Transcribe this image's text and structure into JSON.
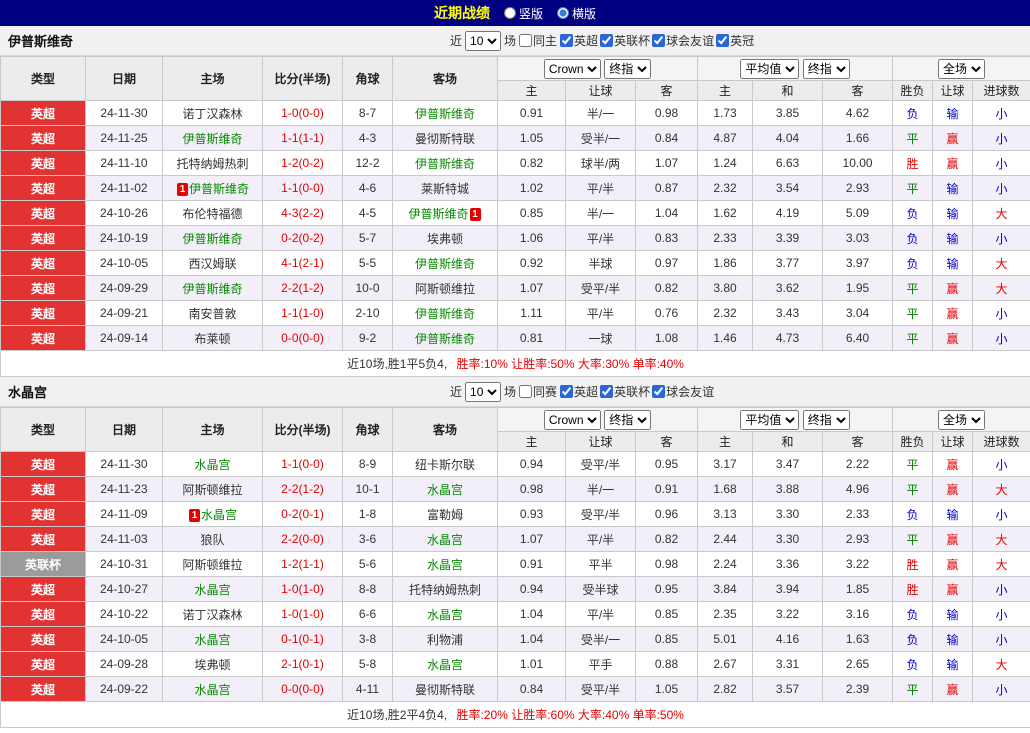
{
  "topbar": {
    "title": "近期战绩",
    "vertical": "竖版",
    "horizontal": "横版"
  },
  "filters_shared": {
    "near": "近",
    "count": "10",
    "games": "场"
  },
  "dropdowns": {
    "bookmaker": "Crown",
    "final": "终指",
    "average": "平均值",
    "full": "全场"
  },
  "columns": {
    "type": "类型",
    "date": "日期",
    "home": "主场",
    "score": "比分(半场)",
    "corner": "角球",
    "away": "客场",
    "odds_home": "主",
    "handicap": "让球",
    "odds_away": "客",
    "avg_home": "主",
    "avg_draw": "和",
    "avg_away": "客",
    "result": "胜负",
    "handicap_result": "让球",
    "goals": "进球数"
  },
  "colors": {
    "value": {
      "胜": "#e60000",
      "平": "#007b00",
      "负": "#0000d0",
      "赢": "#e60000",
      "输": "#0000d0",
      "大": "#e60000",
      "小": "#0000d0"
    },
    "league": {
      "英超": "#e23333",
      "英联杯": "#9b9b9b"
    },
    "score": "#e60000",
    "focus_team": "#078a00"
  },
  "sections": [
    {
      "team": "伊普斯维奇",
      "filter": {
        "same_label": "同主",
        "leagues": [
          "英超",
          "英联杯",
          "球会友谊",
          "英冠"
        ]
      },
      "rows": [
        {
          "league": "英超",
          "date": "24-11-30",
          "home": {
            "name": "诺丁汉森林"
          },
          "score": "1-0(0-0)",
          "corner": "8-7",
          "away": {
            "name": "伊普斯维奇",
            "focus": true
          },
          "odds": [
            "0.91",
            "半/一",
            "0.98"
          ],
          "avg": [
            "1.73",
            "3.85",
            "4.62"
          ],
          "results": [
            "负",
            "输",
            "小"
          ]
        },
        {
          "league": "英超",
          "date": "24-11-25",
          "home": {
            "name": "伊普斯维奇",
            "focus": true
          },
          "score": "1-1(1-1)",
          "corner": "4-3",
          "away": {
            "name": "曼彻斯特联"
          },
          "odds": [
            "1.05",
            "受半/一",
            "0.84"
          ],
          "avg": [
            "4.87",
            "4.04",
            "1.66"
          ],
          "results": [
            "平",
            "赢",
            "小"
          ]
        },
        {
          "league": "英超",
          "date": "24-11-10",
          "home": {
            "name": "托特纳姆热刺"
          },
          "score": "1-2(0-2)",
          "corner": "12-2",
          "away": {
            "name": "伊普斯维奇",
            "focus": true
          },
          "odds": [
            "0.82",
            "球半/两",
            "1.07"
          ],
          "avg": [
            "1.24",
            "6.63",
            "10.00"
          ],
          "results": [
            "胜",
            "赢",
            "小"
          ]
        },
        {
          "league": "英超",
          "date": "24-11-02",
          "home": {
            "name": "伊普斯维奇",
            "focus": true,
            "card": "before"
          },
          "score": "1-1(0-0)",
          "corner": "4-6",
          "away": {
            "name": "莱斯特城"
          },
          "odds": [
            "1.02",
            "平/半",
            "0.87"
          ],
          "avg": [
            "2.32",
            "3.54",
            "2.93"
          ],
          "results": [
            "平",
            "输",
            "小"
          ]
        },
        {
          "league": "英超",
          "date": "24-10-26",
          "home": {
            "name": "布伦特福德"
          },
          "score": "4-3(2-2)",
          "corner": "4-5",
          "away": {
            "name": "伊普斯维奇",
            "focus": true,
            "card": "after"
          },
          "odds": [
            "0.85",
            "半/一",
            "1.04"
          ],
          "avg": [
            "1.62",
            "4.19",
            "5.09"
          ],
          "results": [
            "负",
            "输",
            "大"
          ]
        },
        {
          "league": "英超",
          "date": "24-10-19",
          "home": {
            "name": "伊普斯维奇",
            "focus": true
          },
          "score": "0-2(0-2)",
          "corner": "5-7",
          "away": {
            "name": "埃弗顿"
          },
          "odds": [
            "1.06",
            "平/半",
            "0.83"
          ],
          "avg": [
            "2.33",
            "3.39",
            "3.03"
          ],
          "results": [
            "负",
            "输",
            "小"
          ]
        },
        {
          "league": "英超",
          "date": "24-10-05",
          "home": {
            "name": "西汉姆联"
          },
          "score": "4-1(2-1)",
          "corner": "5-5",
          "away": {
            "name": "伊普斯维奇",
            "focus": true
          },
          "odds": [
            "0.92",
            "半球",
            "0.97"
          ],
          "avg": [
            "1.86",
            "3.77",
            "3.97"
          ],
          "results": [
            "负",
            "输",
            "大"
          ]
        },
        {
          "league": "英超",
          "date": "24-09-29",
          "home": {
            "name": "伊普斯维奇",
            "focus": true
          },
          "score": "2-2(1-2)",
          "corner": "10-0",
          "away": {
            "name": "阿斯顿维拉"
          },
          "odds": [
            "1.07",
            "受平/半",
            "0.82"
          ],
          "avg": [
            "3.80",
            "3.62",
            "1.95"
          ],
          "results": [
            "平",
            "赢",
            "大"
          ]
        },
        {
          "league": "英超",
          "date": "24-09-21",
          "home": {
            "name": "南安普敦"
          },
          "score": "1-1(1-0)",
          "corner": "2-10",
          "away": {
            "name": "伊普斯维奇",
            "focus": true
          },
          "odds": [
            "1.11",
            "平/半",
            "0.76"
          ],
          "avg": [
            "2.32",
            "3.43",
            "3.04"
          ],
          "results": [
            "平",
            "赢",
            "小"
          ]
        },
        {
          "league": "英超",
          "date": "24-09-14",
          "home": {
            "name": "布莱顿"
          },
          "score": "0-0(0-0)",
          "corner": "9-2",
          "away": {
            "name": "伊普斯维奇",
            "focus": true
          },
          "odds": [
            "0.81",
            "一球",
            "1.08"
          ],
          "avg": [
            "1.46",
            "4.73",
            "6.40"
          ],
          "results": [
            "平",
            "赢",
            "小"
          ]
        }
      ],
      "summary": {
        "record": "近10场,胜1平5负4,",
        "stats": "胜率:10% 让胜率:50% 大率:30% 单率:40%"
      }
    },
    {
      "team": "水晶宫",
      "filter": {
        "same_label": "同赛",
        "leagues": [
          "英超",
          "英联杯",
          "球会友谊"
        ]
      },
      "rows": [
        {
          "league": "英超",
          "date": "24-11-30",
          "home": {
            "name": "水晶宫",
            "focus": true
          },
          "score": "1-1(0-0)",
          "corner": "8-9",
          "away": {
            "name": "纽卡斯尔联"
          },
          "odds": [
            "0.94",
            "受平/半",
            "0.95"
          ],
          "avg": [
            "3.17",
            "3.47",
            "2.22"
          ],
          "results": [
            "平",
            "赢",
            "小"
          ]
        },
        {
          "league": "英超",
          "date": "24-11-23",
          "home": {
            "name": "阿斯顿维拉"
          },
          "score": "2-2(1-2)",
          "corner": "10-1",
          "away": {
            "name": "水晶宫",
            "focus": true
          },
          "odds": [
            "0.98",
            "半/一",
            "0.91"
          ],
          "avg": [
            "1.68",
            "3.88",
            "4.96"
          ],
          "results": [
            "平",
            "赢",
            "大"
          ]
        },
        {
          "league": "英超",
          "date": "24-11-09",
          "home": {
            "name": "水晶宫",
            "focus": true,
            "card": "before"
          },
          "score": "0-2(0-1)",
          "corner": "1-8",
          "away": {
            "name": "富勒姆"
          },
          "odds": [
            "0.93",
            "受平/半",
            "0.96"
          ],
          "avg": [
            "3.13",
            "3.30",
            "2.33"
          ],
          "results": [
            "负",
            "输",
            "小"
          ]
        },
        {
          "league": "英超",
          "date": "24-11-03",
          "home": {
            "name": "狼队"
          },
          "score": "2-2(0-0)",
          "corner": "3-6",
          "away": {
            "name": "水晶宫",
            "focus": true
          },
          "odds": [
            "1.07",
            "平/半",
            "0.82"
          ],
          "avg": [
            "2.44",
            "3.30",
            "2.93"
          ],
          "results": [
            "平",
            "赢",
            "大"
          ]
        },
        {
          "league": "英联杯",
          "date": "24-10-31",
          "home": {
            "name": "阿斯顿维拉"
          },
          "score": "1-2(1-1)",
          "corner": "5-6",
          "away": {
            "name": "水晶宫",
            "focus": true
          },
          "odds": [
            "0.91",
            "平半",
            "0.98"
          ],
          "avg": [
            "2.24",
            "3.36",
            "3.22"
          ],
          "results": [
            "胜",
            "赢",
            "大"
          ]
        },
        {
          "league": "英超",
          "date": "24-10-27",
          "home": {
            "name": "水晶宫",
            "focus": true
          },
          "score": "1-0(1-0)",
          "corner": "8-8",
          "away": {
            "name": "托特纳姆热刺"
          },
          "odds": [
            "0.94",
            "受半球",
            "0.95"
          ],
          "avg": [
            "3.84",
            "3.94",
            "1.85"
          ],
          "results": [
            "胜",
            "赢",
            "小"
          ]
        },
        {
          "league": "英超",
          "date": "24-10-22",
          "home": {
            "name": "诺丁汉森林"
          },
          "score": "1-0(1-0)",
          "corner": "6-6",
          "away": {
            "name": "水晶宫",
            "focus": true
          },
          "odds": [
            "1.04",
            "平/半",
            "0.85"
          ],
          "avg": [
            "2.35",
            "3.22",
            "3.16"
          ],
          "results": [
            "负",
            "输",
            "小"
          ]
        },
        {
          "league": "英超",
          "date": "24-10-05",
          "home": {
            "name": "水晶宫",
            "focus": true
          },
          "score": "0-1(0-1)",
          "corner": "3-8",
          "away": {
            "name": "利物浦"
          },
          "odds": [
            "1.04",
            "受半/一",
            "0.85"
          ],
          "avg": [
            "5.01",
            "4.16",
            "1.63"
          ],
          "results": [
            "负",
            "输",
            "小"
          ]
        },
        {
          "league": "英超",
          "date": "24-09-28",
          "home": {
            "name": "埃弗顿"
          },
          "score": "2-1(0-1)",
          "corner": "5-8",
          "away": {
            "name": "水晶宫",
            "focus": true
          },
          "odds": [
            "1.01",
            "平手",
            "0.88"
          ],
          "avg": [
            "2.67",
            "3.31",
            "2.65"
          ],
          "results": [
            "负",
            "输",
            "大"
          ]
        },
        {
          "league": "英超",
          "date": "24-09-22",
          "home": {
            "name": "水晶宫",
            "focus": true
          },
          "score": "0-0(0-0)",
          "corner": "4-11",
          "away": {
            "name": "曼彻斯特联"
          },
          "odds": [
            "0.84",
            "受平/半",
            "1.05"
          ],
          "avg": [
            "2.82",
            "3.57",
            "2.39"
          ],
          "results": [
            "平",
            "赢",
            "小"
          ]
        }
      ],
      "summary": {
        "record": "近10场,胜2平4负4,",
        "stats": "胜率:20% 让胜率:60% 大率:40% 单率:50%"
      }
    }
  ]
}
